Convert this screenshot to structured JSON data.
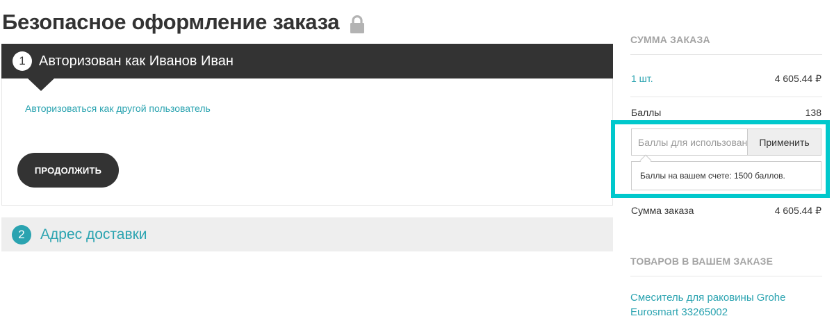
{
  "page": {
    "title": "Безопасное оформление заказа",
    "lock_icon": "lock-icon"
  },
  "step1": {
    "number": "1",
    "title": "Авторизован как Иванов Иван",
    "other_user_link": "Авторизоваться как другой пользователь",
    "continue_label": "ПРОДОЛЖИТЬ"
  },
  "step2": {
    "number": "2",
    "title": "Адрес доставки"
  },
  "summary": {
    "title": "СУММА ЗАКАЗА",
    "qty_label": "1 шт.",
    "qty_value": "4 605.44 ₽",
    "points_label": "Баллы",
    "points_value": "138",
    "points_input_placeholder": "Баллы для использования",
    "apply_label": "Применить",
    "points_tooltip": "Баллы на вашем счете: 1500 баллов.",
    "total_label": "Сумма заказа",
    "total_value": "4 605.44 ₽"
  },
  "items": {
    "title": "ТОВАРОВ В ВАШЕМ ЗАКАЗЕ",
    "product_name": "Смеситель для раковины Grohe Eurosmart 33265002"
  },
  "colors": {
    "accent": "#2aa3b0",
    "dark": "#333333",
    "highlight": "#00c8cc"
  }
}
